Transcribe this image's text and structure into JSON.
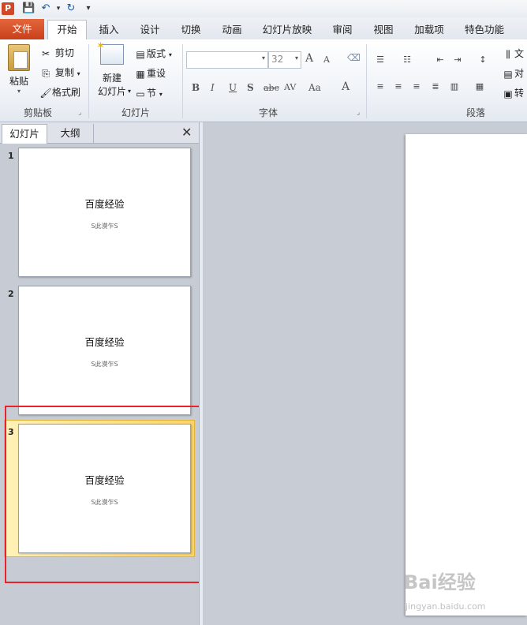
{
  "qat": {
    "app_icon": "P",
    "save_icon": "💾",
    "undo_icon": "↶",
    "redo_icon": "↻",
    "customize_icon": "▾"
  },
  "tabs": [
    {
      "label": "文件"
    },
    {
      "label": "开始"
    },
    {
      "label": "插入"
    },
    {
      "label": "设计"
    },
    {
      "label": "切换"
    },
    {
      "label": "动画"
    },
    {
      "label": "幻灯片放映"
    },
    {
      "label": "审阅"
    },
    {
      "label": "视图"
    },
    {
      "label": "加载项"
    },
    {
      "label": "特色功能"
    }
  ],
  "ribbon": {
    "clipboard": {
      "paste": "粘贴",
      "cut": "剪切",
      "copy": "复制",
      "format_painter": "格式刷",
      "label": "剪贴板"
    },
    "slides": {
      "new_slide_1": "新建",
      "new_slide_2": "幻灯片",
      "layout": "版式",
      "reset": "重设",
      "section": "节",
      "label": "幻灯片"
    },
    "font": {
      "font_name": "",
      "font_size": "32",
      "label": "字体",
      "bold": "B",
      "italic": "I",
      "underline": "U",
      "shadow": "S",
      "strike": "abc",
      "spacing": "AV",
      "case": "Aa",
      "color": "A",
      "grow": "A",
      "shrink": "A"
    },
    "paragraph": {
      "label": "段落",
      "text_dir": "文",
      "align_text": "对",
      "convert": "转"
    }
  },
  "pane": {
    "tab_slides": "幻灯片",
    "tab_outline": "大纲",
    "close": "✕",
    "slides": [
      {
        "num": "1",
        "title": "百度经验",
        "subtitle": "S此漠乍S"
      },
      {
        "num": "2",
        "title": "百度经验",
        "subtitle": "S此漠乍S"
      },
      {
        "num": "3",
        "title": "百度经验",
        "subtitle": "S此漠乍S"
      }
    ]
  },
  "watermark": {
    "logo": "Bai经验",
    "url": "jingyan.baidu.com"
  },
  "colors": {
    "file_tab": "#d24726",
    "selection": "#fbd46a",
    "annotation": "#e8232a"
  }
}
